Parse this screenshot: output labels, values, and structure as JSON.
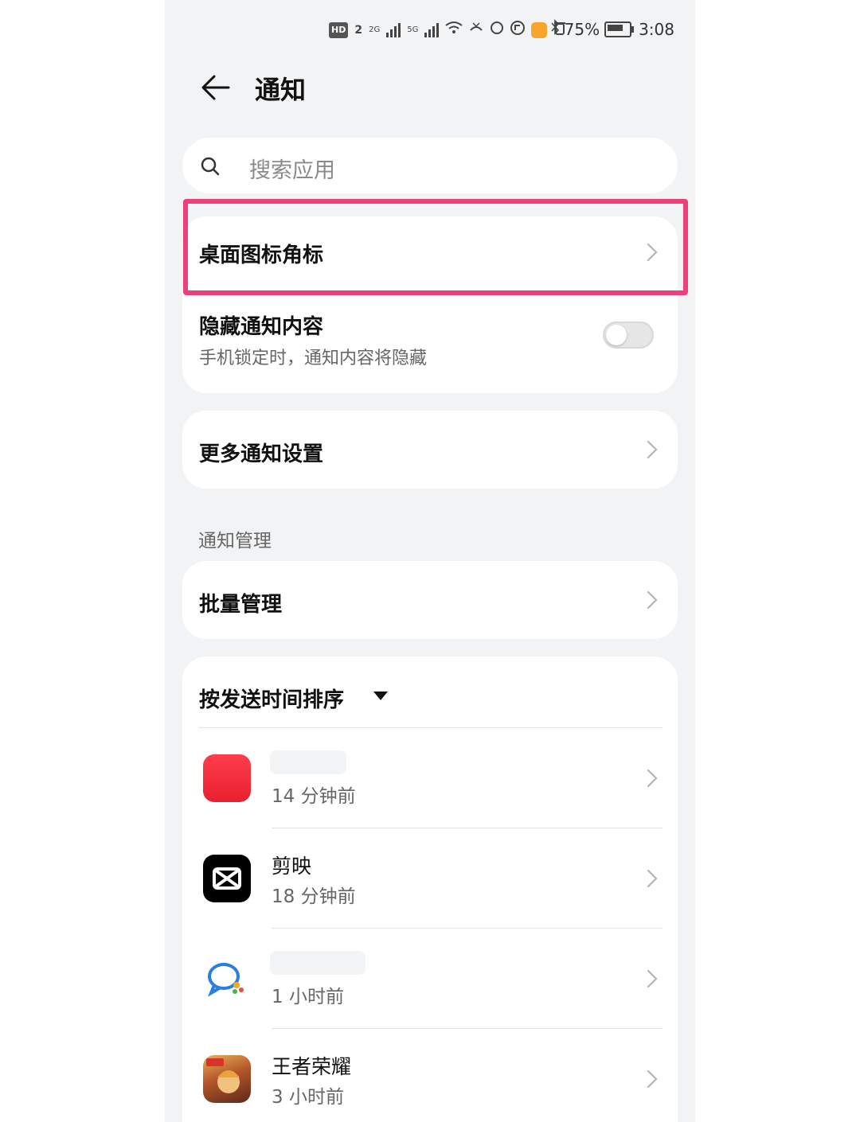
{
  "status_bar": {
    "hd_label": "HD",
    "sim_slot": "2",
    "network_1": "2G",
    "network_2": "5G",
    "battery_percent": "75%",
    "time": "3:08"
  },
  "header": {
    "title": "通知"
  },
  "search": {
    "placeholder": "搜索应用"
  },
  "settings": {
    "badge_row_label": "桌面图标角标",
    "hide_content_label": "隐藏通知内容",
    "hide_content_sub": "手机锁定时，通知内容将隐藏",
    "hide_content_enabled": false,
    "more_settings_label": "更多通知设置"
  },
  "management": {
    "section_label": "通知管理",
    "batch_label": "批量管理",
    "sort_label": "按发送时间排序"
  },
  "apps": [
    {
      "name": "",
      "time": "14 分钟前",
      "icon": "red-app-icon",
      "color": "#f0303f"
    },
    {
      "name": "剪映",
      "time": "18 分钟前",
      "icon": "capcut-icon",
      "color": "#000000"
    },
    {
      "name": "",
      "time": "1 小时前",
      "icon": "chat-bubble-app-icon",
      "color": "#2a7de1"
    },
    {
      "name": "王者荣耀",
      "time": "3 小时前",
      "icon": "honor-of-kings-icon",
      "color": "#b5552a"
    }
  ],
  "colors": {
    "highlight": "#ee3f7a",
    "page_background": "#f1f3f5"
  }
}
